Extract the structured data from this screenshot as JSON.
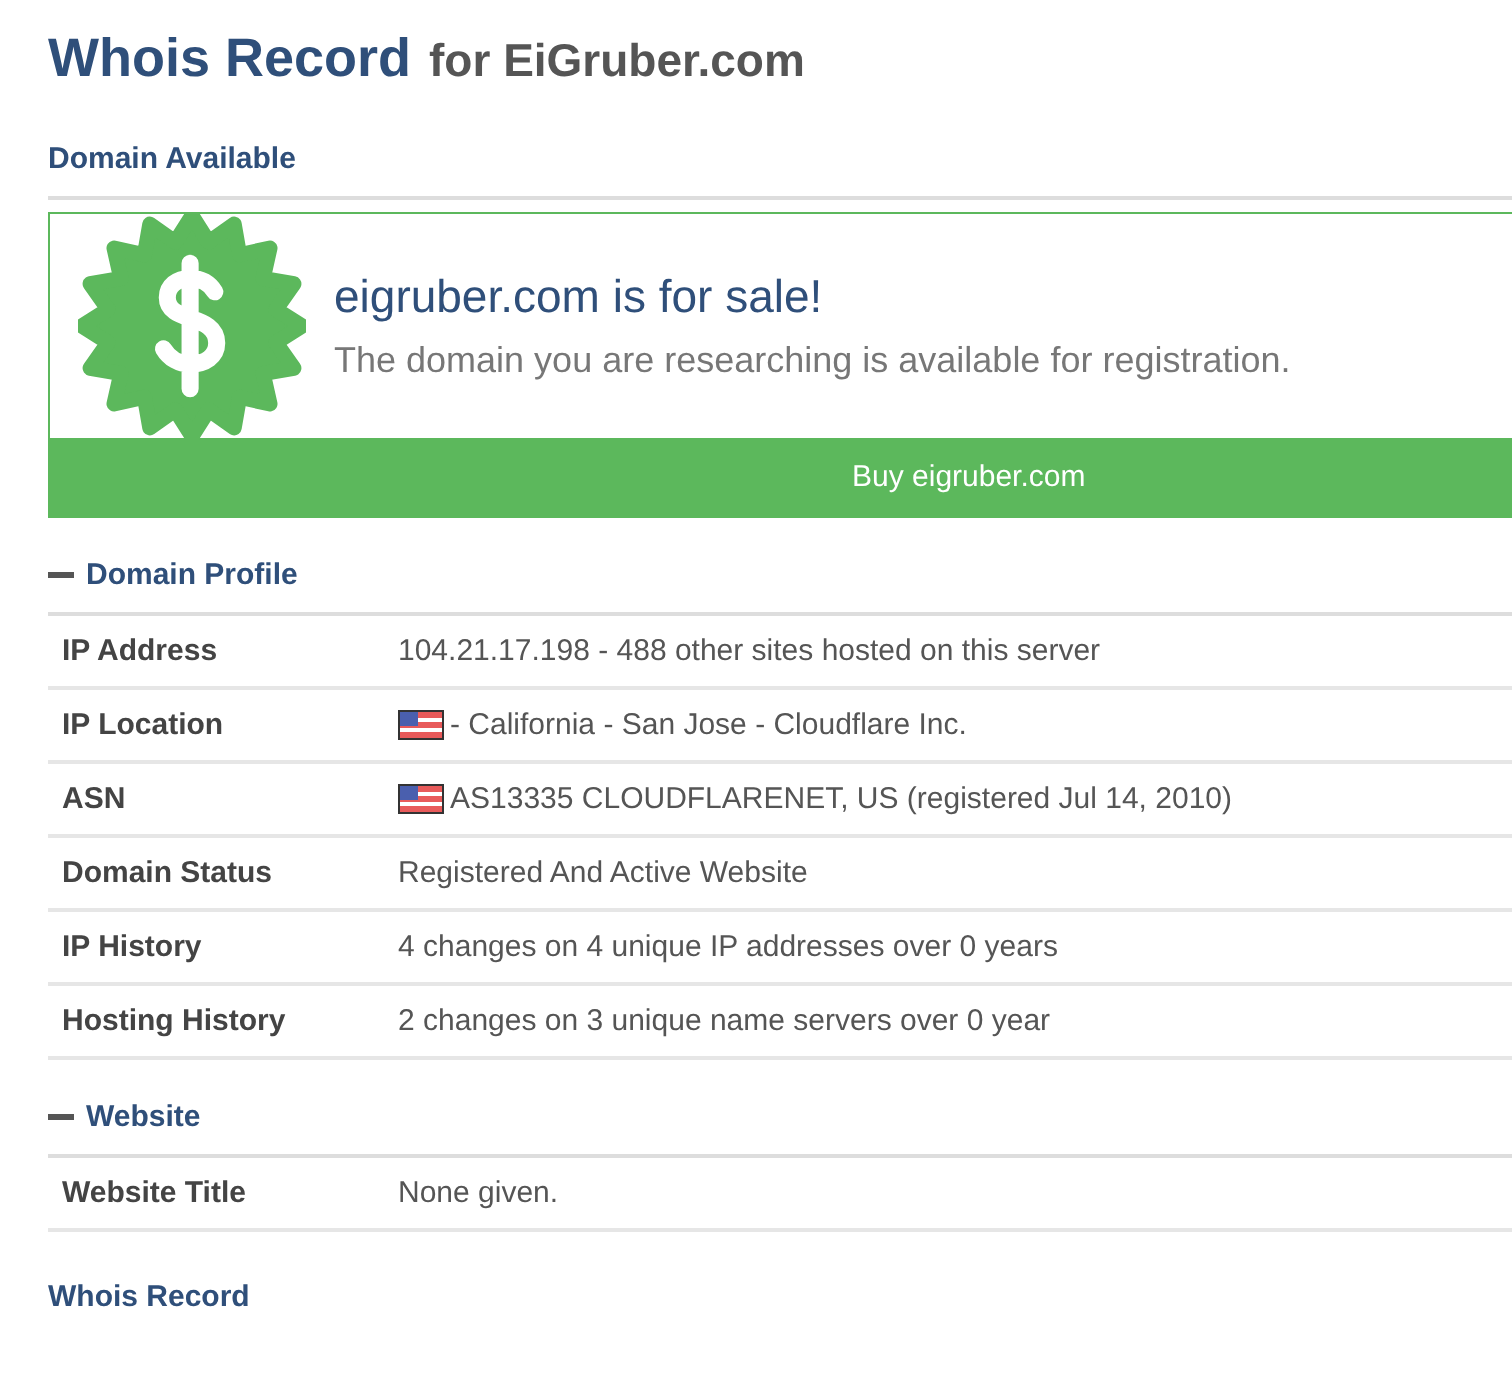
{
  "title": {
    "main": "Whois Record",
    "suffix": "for EiGruber.com"
  },
  "availability": {
    "heading": "Domain Available",
    "headline": "eigruber.com is for sale!",
    "message": "The domain you are researching is available for registration.",
    "button": "Buy eigruber.com"
  },
  "sections": [
    {
      "title": "Domain Profile",
      "expanded": true,
      "rows": [
        {
          "label": "IP Address",
          "value": "104.21.17.198 - 488 other sites hosted on this server",
          "flag": false
        },
        {
          "label": "IP Location",
          "value": "- California - San Jose - Cloudflare Inc.",
          "flag": true
        },
        {
          "label": "ASN",
          "value": "AS13335 CLOUDFLARENET, US (registered Jul 14, 2010)",
          "flag": true
        },
        {
          "label": "Domain Status",
          "value": "Registered And Active Website",
          "flag": false
        },
        {
          "label": "IP History",
          "value": "4 changes on 4 unique IP addresses over 0 years",
          "flag": false
        },
        {
          "label": "Hosting History",
          "value": "2 changes on 3 unique name servers over 0 year",
          "flag": false
        }
      ]
    },
    {
      "title": "Website",
      "expanded": true,
      "rows": [
        {
          "label": "Website Title",
          "value": "None given.",
          "flag": false
        }
      ]
    }
  ],
  "footer_heading": "Whois Record"
}
